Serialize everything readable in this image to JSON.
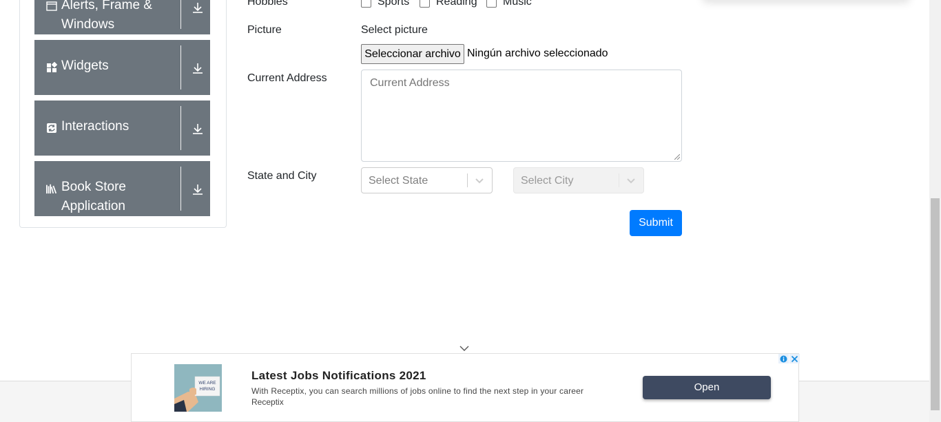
{
  "sidebar": {
    "groups": [
      {
        "label": "Alerts, Frame & Windows",
        "icon": "window-icon"
      },
      {
        "label": "Widgets",
        "icon": "widgets-icon"
      },
      {
        "label": "Interactions",
        "icon": "interactions-icon"
      },
      {
        "label": "Book Store Application",
        "icon": "books-icon"
      }
    ]
  },
  "form": {
    "hobbies": {
      "label": "Hobbies",
      "options": [
        "Sports",
        "Reading",
        "Music"
      ]
    },
    "picture": {
      "label": "Picture",
      "hint": "Select picture",
      "button_label": "Seleccionar archivo",
      "status": "Ningún archivo seleccionado"
    },
    "current_address": {
      "label": "Current Address",
      "placeholder": "Current Address"
    },
    "state_city": {
      "label": "State and City",
      "state_placeholder": "Select State",
      "city_placeholder": "Select City"
    },
    "submit_label": "Submit"
  },
  "ad": {
    "title": "Latest Jobs Notifications 2021",
    "description": "With Receptix, you can search millions of jobs online to find the next step in your career",
    "brand": "Receptix",
    "cta": "Open",
    "image_text": [
      "WE ARE",
      "HIRING"
    ]
  },
  "colors": {
    "sidebar_group_bg": "#6c757d",
    "submit_bg": "#007bff",
    "ad_button_bg": "#3e4a61"
  }
}
